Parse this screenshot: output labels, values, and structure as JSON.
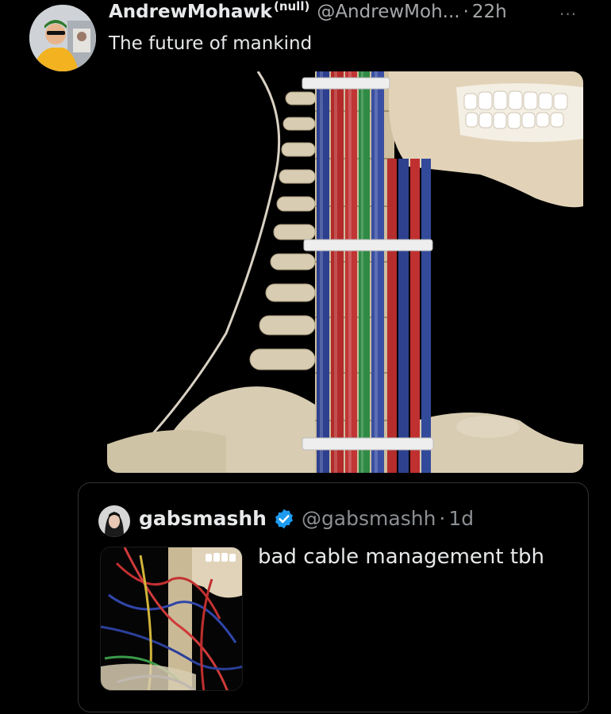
{
  "tweet": {
    "display_name": "AndrewMohawk",
    "name_suffix": "(null)",
    "handle": "@AndrewMoh...",
    "separator": "·",
    "time": "22h",
    "more_label": "···",
    "text": "The future of mankind",
    "avatar_icon": "user-avatar",
    "media_icon": "anatomy-spine-cables-image"
  },
  "quote": {
    "display_name": "gabsmashh",
    "verified_icon": "verified-badge-icon",
    "handle": "@gabsmashh",
    "separator": "·",
    "time": "1d",
    "text": "bad cable management tbh",
    "avatar_icon": "user-avatar",
    "media_icon": "anatomy-neck-vessels-image"
  },
  "colors": {
    "background": "#000000",
    "text": "#e7e9ea",
    "muted": "#a5a8ab",
    "verified": "#1d9bf0",
    "border": "#2f3336"
  }
}
